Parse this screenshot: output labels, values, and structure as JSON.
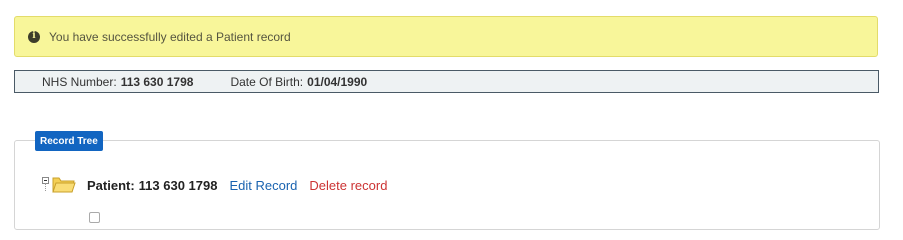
{
  "alert": {
    "icon": "info-icon",
    "message": "You have successfully edited a Patient record",
    "background_color": "#f8f69a"
  },
  "patient_banner": {
    "nhs_label": "NHS Number:",
    "nhs_value": "113 630 1798",
    "dob_label": "Date Of Birth:",
    "dob_value": "01/04/1990"
  },
  "record_tree": {
    "badge": "Record Tree",
    "badge_color": "#1265c1",
    "root_node": {
      "icon": "folder-icon",
      "label": "Patient:",
      "value": "113 630 1798",
      "edit_link": "Edit Record",
      "delete_link": "Delete record",
      "edit_color": "#1a63b0",
      "delete_color": "#cc3333"
    }
  }
}
